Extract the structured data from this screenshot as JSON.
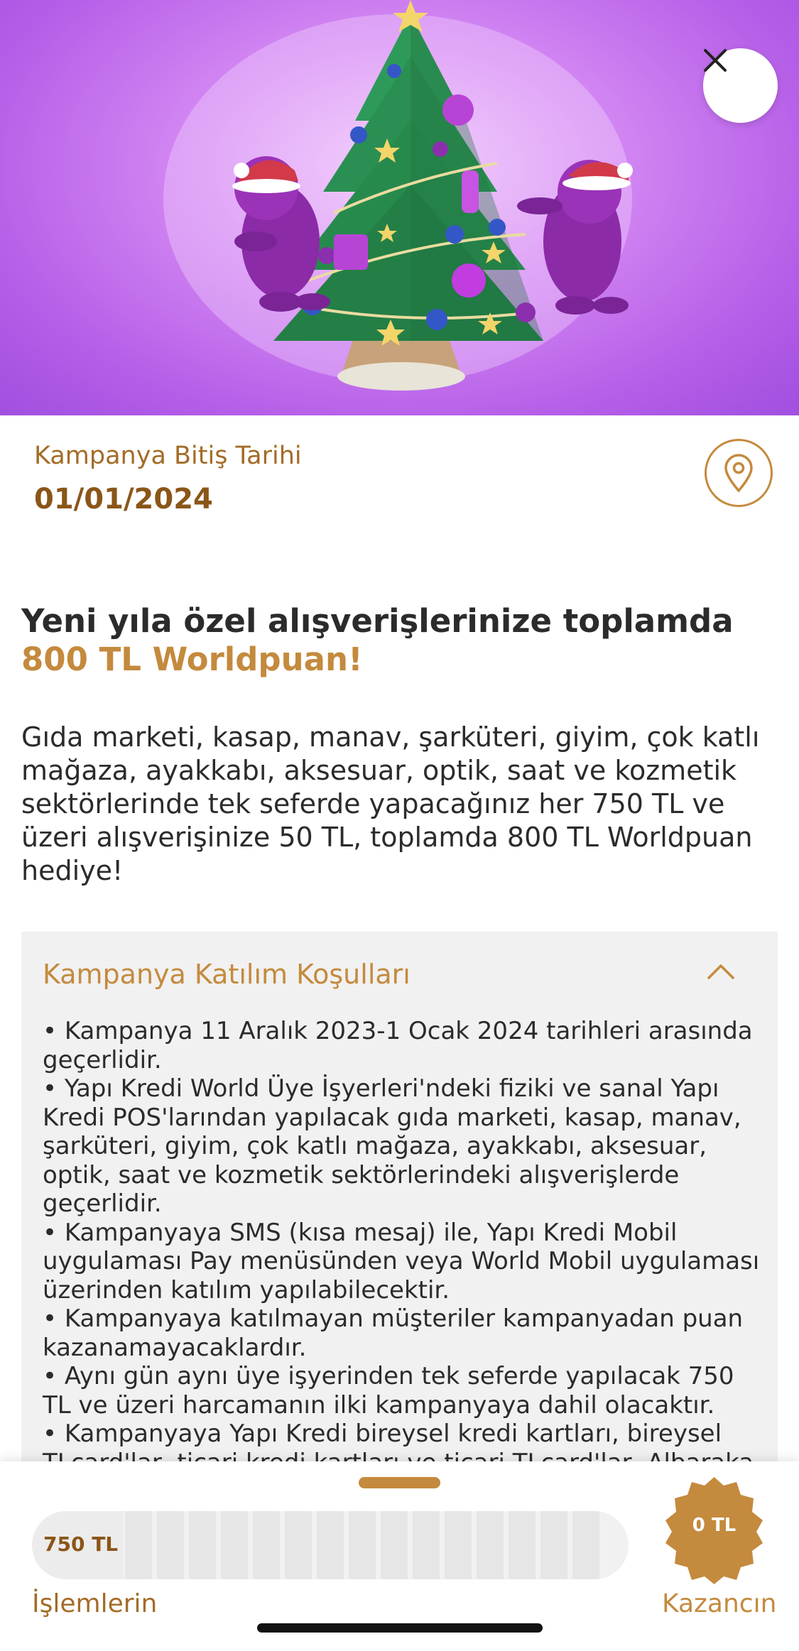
{
  "colors": {
    "accent": "#c48a3d",
    "accent_dark": "#8a5618",
    "hero_bg": "#b55ee8",
    "panel_bg": "#f1f1f1"
  },
  "hero": {
    "image_name": "christmas-tree-illustration",
    "close_icon": "close-icon"
  },
  "campaign": {
    "end_date_label": "Kampanya Bitiş Tarihi",
    "end_date": "01/01/2024",
    "location_icon": "location-pin-icon",
    "title_main": "Yeni yıla özel alışverişlerinize toplamda ",
    "title_accent": "800 TL Worldpuan!",
    "description": "Gıda marketi, kasap, manav, şarküteri, giyim, çok katlı mağaza, ayakkabı, aksesuar, optik, saat ve kozmetik sektörlerinde tek seferde yapacağınız her 750 TL ve üzeri alışverişinize 50 TL, toplamda 800 TL Worldpuan hediye!"
  },
  "conditions": {
    "title": "Kampanya Katılım Koşulları",
    "expanded": true,
    "items": [
      "• Kampanya 11 Aralık 2023-1 Ocak 2024 tarihleri arasında geçerlidir.",
      "• Yapı Kredi World Üye İşyerleri'ndeki fiziki ve sanal Yapı Kredi POS'larından yapılacak gıda marketi, kasap, manav, şarküteri, giyim, çok katlı mağaza, ayakkabı, aksesuar, optik, saat ve kozmetik sektörlerindeki alışverişlerde geçerlidir.",
      "• Kampanyaya SMS (kısa mesaj) ile, Yapı Kredi Mobil uygulaması Pay menüsünden veya World Mobil uygulaması üzerinden katılım yapılabilecektir.",
      "• Kampanyaya katılmayan müşteriler kampanyadan puan kazanamayacaklardır.",
      "• Aynı gün aynı üye işyerinden tek seferde yapılacak 750 TL ve üzeri harcamanın ilki kampanyaya dahil olacaktır.",
      "• Kampanyaya Yapı Kredi bireysel kredi kartları, bireysel TLcard'lar, ticari kredi kartları ve ticari TLcard'lar, Albaraka Worldcard'lar dahildir. Anadolubank ve Vakıfbank"
    ]
  },
  "tracker": {
    "step_label": "750 TL",
    "transactions_label": "İşlemlerin",
    "earned_value": "0 TL",
    "earned_label": "Kazancın",
    "progress": 0
  }
}
